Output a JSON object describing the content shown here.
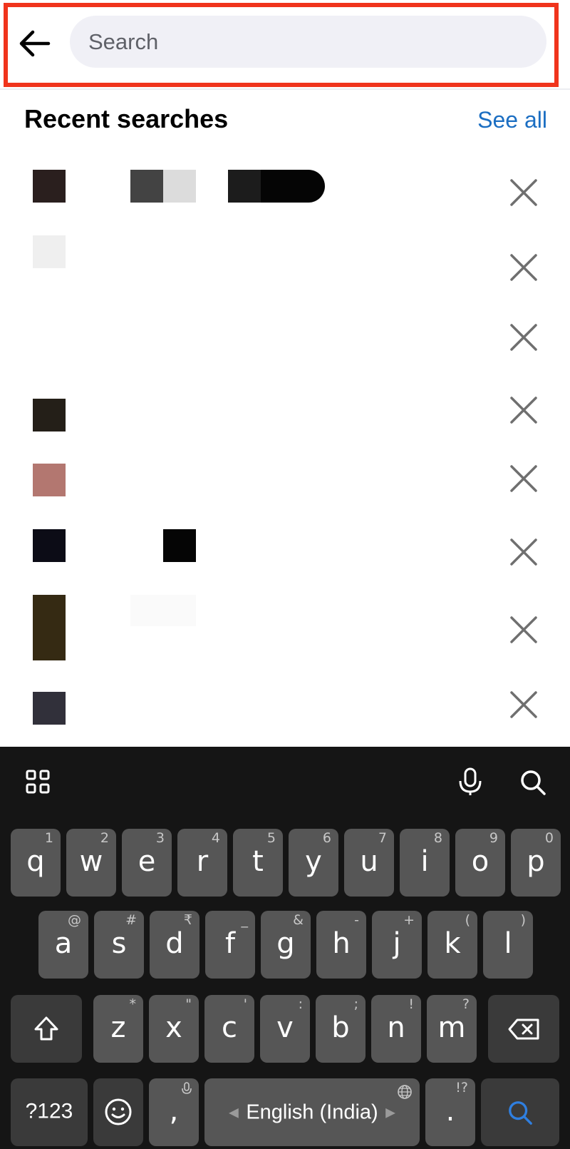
{
  "header": {
    "search_placeholder": "Search"
  },
  "recent": {
    "title": "Recent searches",
    "see_all": "See all",
    "items": [
      {
        "thumb_color": "#2a1f1e"
      },
      {
        "thumb_color": "#efefef"
      },
      {
        "thumb_color": ""
      },
      {
        "thumb_color": "#241f18"
      },
      {
        "thumb_color": "#b37770"
      },
      {
        "thumb_color": "#0c0c16"
      },
      {
        "thumb_color": "#352a13"
      },
      {
        "thumb_color": "#31303a"
      }
    ]
  },
  "keyboard": {
    "row1": [
      {
        "k": "q",
        "h": "1"
      },
      {
        "k": "w",
        "h": "2"
      },
      {
        "k": "e",
        "h": "3"
      },
      {
        "k": "r",
        "h": "4"
      },
      {
        "k": "t",
        "h": "5"
      },
      {
        "k": "y",
        "h": "6"
      },
      {
        "k": "u",
        "h": "7"
      },
      {
        "k": "i",
        "h": "8"
      },
      {
        "k": "o",
        "h": "9"
      },
      {
        "k": "p",
        "h": "0"
      }
    ],
    "row2": [
      {
        "k": "a",
        "h": "@"
      },
      {
        "k": "s",
        "h": "#"
      },
      {
        "k": "d",
        "h": "₹"
      },
      {
        "k": "f",
        "h": "_"
      },
      {
        "k": "g",
        "h": "&"
      },
      {
        "k": "h",
        "h": "-"
      },
      {
        "k": "j",
        "h": "+"
      },
      {
        "k": "k",
        "h": "("
      },
      {
        "k": "l",
        "h": ")"
      }
    ],
    "row3": [
      {
        "k": "z",
        "h": "*"
      },
      {
        "k": "x",
        "h": "\""
      },
      {
        "k": "c",
        "h": "'"
      },
      {
        "k": "v",
        "h": ":"
      },
      {
        "k": "b",
        "h": ";"
      },
      {
        "k": "n",
        "h": "!"
      },
      {
        "k": "m",
        "h": "?"
      }
    ],
    "symbols_key": "?123",
    "comma_key": ",",
    "period_key": ".",
    "period_hint": "!?",
    "space_label": "English (India)"
  },
  "colors": {
    "highlight": "#f0341c",
    "link": "#1b6ec2",
    "key": "#565656",
    "keyboard_bg": "#151515",
    "search_key_icon": "#2f7fe0"
  }
}
